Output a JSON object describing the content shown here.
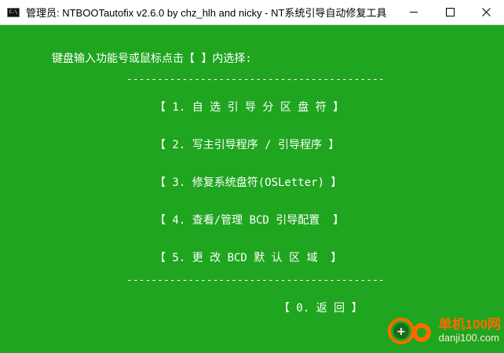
{
  "window": {
    "title": "管理员:  NTBOOTautofix v2.6.0 by chz_hlh and nicky - NT系统引导自动修复工具",
    "icon_label": "C:\\",
    "controls": [
      "minimize-icon",
      "maximize-icon",
      "close-icon"
    ]
  },
  "console": {
    "prompt": "键盘输入功能号或鼠标点击【 】内选择:",
    "separator": "------------------------------------------",
    "menu": [
      "【 1. 自 选 引 导 分 区 盘 符 】",
      "【 2. 写主引导程序 / 引导程序 】",
      "【 3. 修复系统盘符(OSLetter) 】",
      "【 4. 查看/管理 BCD 引导配置  】",
      "【 5. 更 改 BCD 默 认 区 域  】"
    ],
    "back": "【 0. 返 回 】"
  },
  "watermark": {
    "line1": "单机100网",
    "line2": "danji100.com"
  },
  "colors": {
    "console_bg": "#1fa51f",
    "console_text": "#ffffff",
    "titlebar_bg": "#ffffff",
    "watermark_orange": "#ff6a00"
  }
}
